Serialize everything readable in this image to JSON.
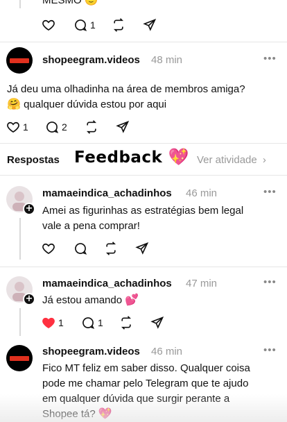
{
  "top_post": {
    "text_tail": "MESMO",
    "reply_count": "1"
  },
  "main_post": {
    "username": "shopeegram.videos",
    "time": "48 min",
    "text_line1": "Já deu uma olhadinha na área de membros amiga?",
    "text_line2": "qualquer dúvida estou por aqui",
    "like_count": "1",
    "reply_count": "2"
  },
  "replies_header": {
    "label": "Respostas",
    "sticker_text": "Feedback",
    "view_activity": "Ver atividade"
  },
  "reply1": {
    "username": "mamaeindica_achadinhos",
    "time": "46 min",
    "text_line1": "Amei as figurinhas as estratégias bem legal",
    "text_line2": "vale a pena comprar!"
  },
  "reply2": {
    "username": "mamaeindica_achadinhos",
    "time": "47 min",
    "text": "Já estou amando",
    "like_count": "1",
    "reply_count": "1"
  },
  "reply3": {
    "username": "shopeegram.videos",
    "time": "46 min",
    "text_line1": "Fico MT feliz em saber disso. Qualquer coisa",
    "text_line2": "pode me chamar pelo Telegram que te ajudo",
    "text_line3": "em qualquer dúvida que surgir perante a",
    "text_line4": "Shopee tá?"
  },
  "colors": {
    "liked_heart": "#ff3040",
    "muted": "#999999",
    "text": "#111111"
  },
  "icons": [
    "heart-icon",
    "comment-icon",
    "repost-icon",
    "share-icon",
    "more-icon",
    "chevron-right-icon",
    "plus-icon",
    "smile-emoji-icon",
    "sparkle-heart-emoji-icon"
  ]
}
